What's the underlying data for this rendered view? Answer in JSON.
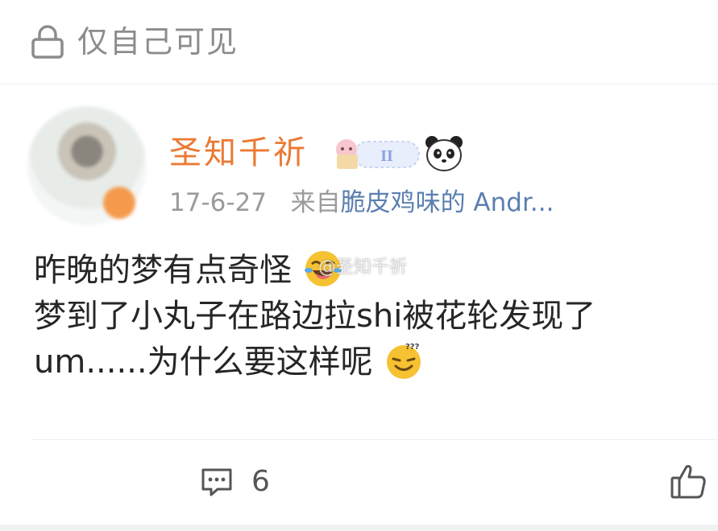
{
  "privacy": {
    "label": "仅自己可见",
    "icon": "lock-icon"
  },
  "post": {
    "author": "圣知千祈",
    "badges": [
      "level-badge-icon",
      "panda-icon"
    ],
    "date": "17-6-27",
    "source_prefix": "来自",
    "source_name": "脆皮鸡味的 Andr...",
    "lines": [
      "昨晚的梦有点奇怪",
      "梦到了小丸子在路边拉shi被花轮发现了",
      "um......为什么要这样呢"
    ],
    "watermark": "@圣知千祈"
  },
  "actions": {
    "comment_count": "6",
    "comment_icon": "comment-icon",
    "like_icon": "thumbs-up-icon"
  },
  "colors": {
    "author": "#eb7a34",
    "source_link": "#5b7fb0",
    "meta": "#9b9b9b",
    "muted": "#8c8c8c"
  }
}
